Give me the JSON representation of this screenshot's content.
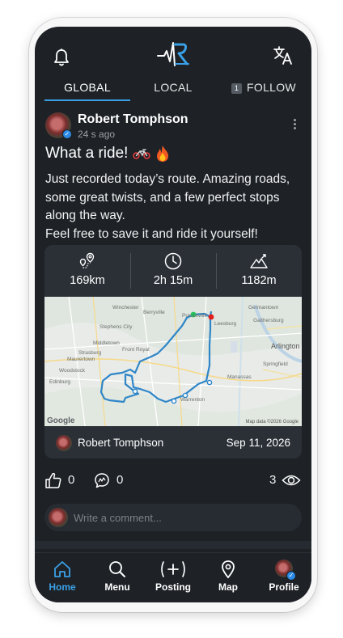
{
  "tabs": [
    {
      "label": "GLOBAL"
    },
    {
      "label": "LOCAL"
    },
    {
      "label": "FOLLOW",
      "count": "1"
    }
  ],
  "post": {
    "author": "Robert Tomphson",
    "time": "24 s ago",
    "title": "What a ride!",
    "body_lines": [
      "Just recorded today’s route. Amazing roads,",
      "some great twists, and a few perfect stops",
      "along the way.",
      "Feel free to save it and ride it yourself!"
    ]
  },
  "ride": {
    "distance": "169km",
    "duration": "2h 15m",
    "elevation": "1182m",
    "author": "Robert Tomphson",
    "date": "Sep 11, 2026",
    "map": {
      "credit": "Map data ©2026 Google",
      "brand": "Google",
      "towns": [
        "Winchester",
        "Berryville",
        "Germantown",
        "Stephens City",
        "Purcellville",
        "Leesburg",
        "Gaithersburg",
        "Middletown",
        "Strasburg",
        "Front Royal",
        "Manassas",
        "Maurertown",
        "Warrenton",
        "Arlington",
        "Woodstock",
        "Edinburg",
        "Springfield"
      ]
    }
  },
  "reactions": {
    "likes": "0",
    "comments": "0",
    "views": "3"
  },
  "comment": {
    "placeholder": "Write a comment..."
  },
  "nav": [
    {
      "label": "Home"
    },
    {
      "label": "Menu"
    },
    {
      "label": "Posting"
    },
    {
      "label": "Map"
    },
    {
      "label": "Profile"
    }
  ],
  "colors": {
    "accent": "#3aa0e6",
    "background": "#1e2227",
    "card": "#2b3037",
    "route": "#2f86c8"
  }
}
